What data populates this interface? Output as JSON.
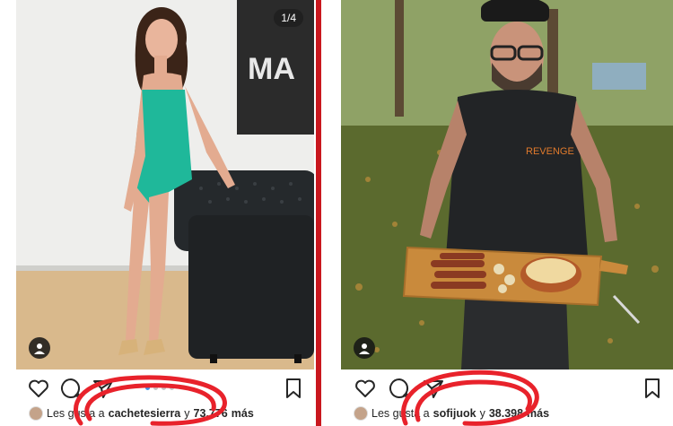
{
  "posts": [
    {
      "image_counter": "1/4",
      "wall_sign": "MA",
      "likes": {
        "prefix": "Les gusta a",
        "user": "cachetesierra",
        "connector": "y",
        "count": "73.776",
        "suffix": "más"
      }
    },
    {
      "shirt_text": "REVENGE",
      "likes": {
        "prefix": "Les gusta a",
        "user": "sofijuok",
        "connector": "y",
        "count": "38.398",
        "suffix": "más"
      }
    }
  ],
  "colors": {
    "divider": "#c9171e",
    "scribble": "#e8222b",
    "dress": "#1fb89a",
    "sofa": "#1f2224",
    "grass": "#5b6a2e",
    "board": "#c98a3c",
    "dot_active": "#3897f0"
  },
  "icons": [
    "heart-icon",
    "comment-icon",
    "share-icon",
    "bookmark-icon",
    "user-tag-icon"
  ]
}
